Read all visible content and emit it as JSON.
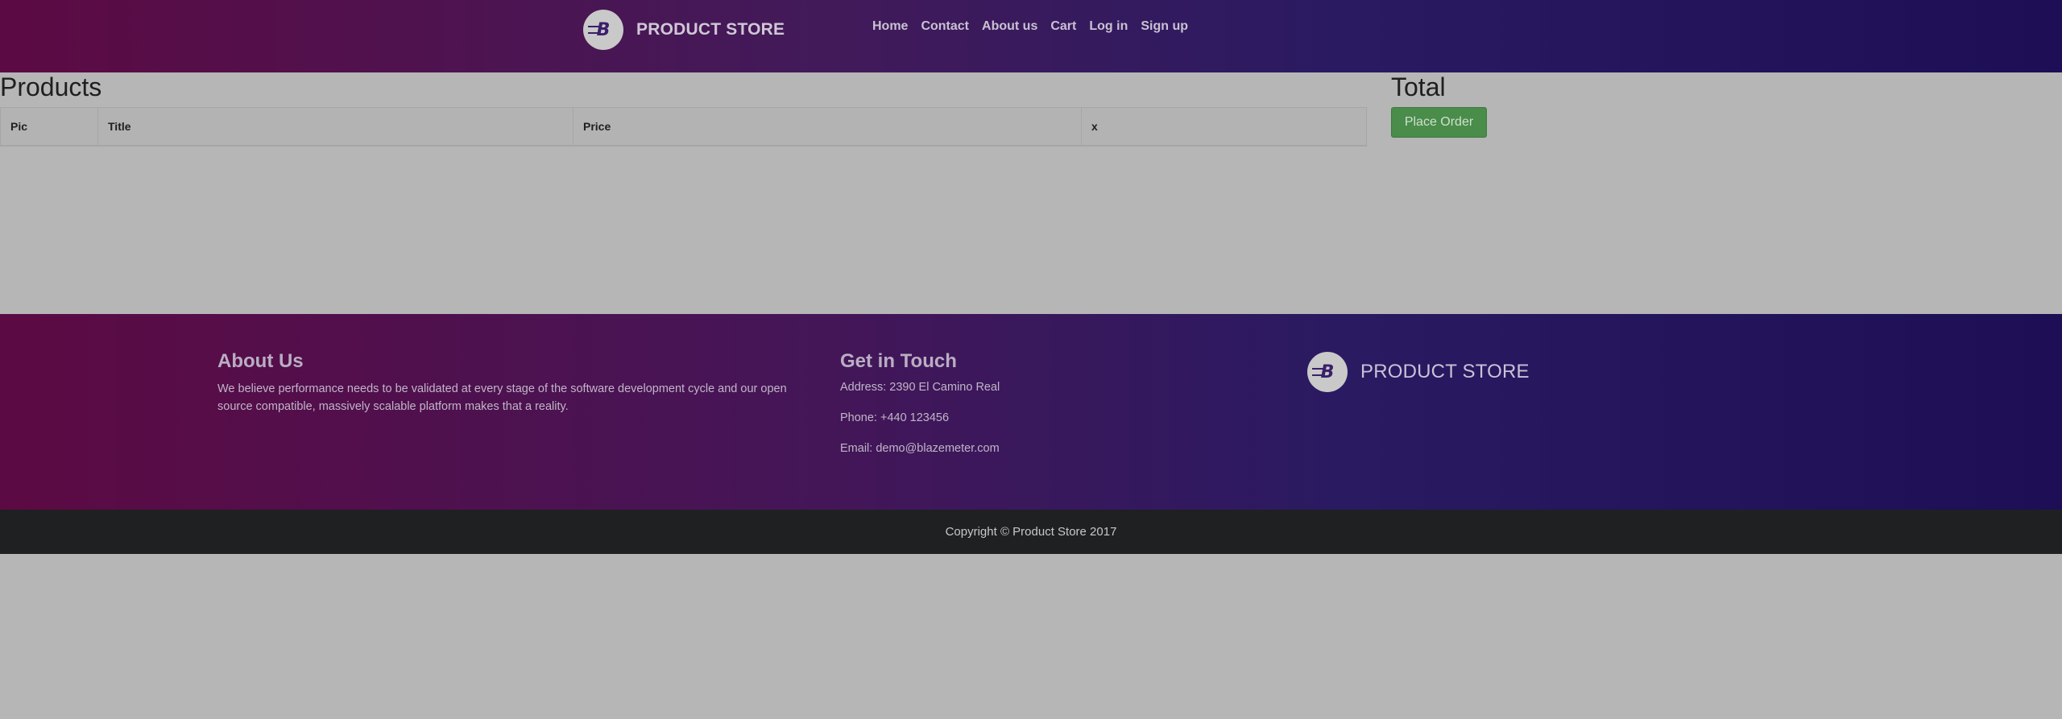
{
  "navbar": {
    "brand": "PRODUCT STORE",
    "logo_letter": "B",
    "links": [
      "Home",
      "Contact",
      "About us",
      "Cart",
      "Log in",
      "Sign up"
    ]
  },
  "cart": {
    "products_heading": "Products",
    "columns": [
      "Pic",
      "Title",
      "Price",
      "x"
    ],
    "total_heading": "Total",
    "place_order_label": "Place Order"
  },
  "footer": {
    "about_title": "About Us",
    "about_text": "We believe performance needs to be validated at every stage of the software development cycle and our open source compatible, massively scalable platform makes that a reality.",
    "touch_title": "Get in Touch",
    "address": "Address: 2390 El Camino Real",
    "phone": "Phone: +440 123456",
    "email": "Email: demo@blazemeter.com",
    "brand": "PRODUCT STORE",
    "logo_letter": "B"
  },
  "copyright": "Copyright © Product Store 2017",
  "colors": {
    "background": "#b6b6b6",
    "gradient_start": "#5c0a43",
    "gradient_end": "#1d0e55",
    "button_green": "#4a8c4a",
    "copyright_bar": "#1f2022"
  },
  "icons": {
    "logo": "blazemeter-logo-icon"
  }
}
